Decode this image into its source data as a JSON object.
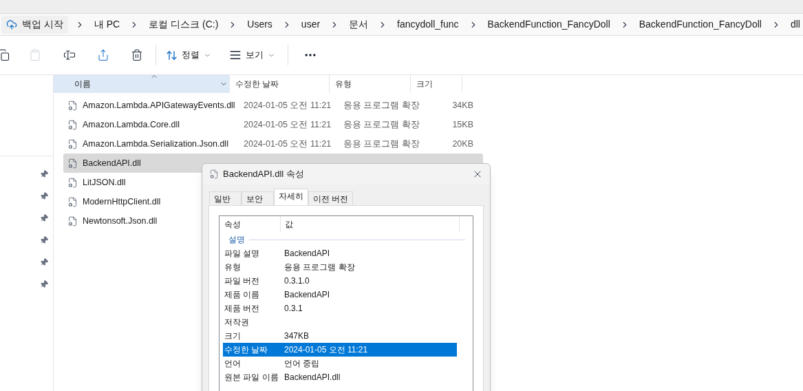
{
  "address_bar": {
    "backup_button": "백업 시작",
    "path": [
      "내 PC",
      "로컬 디스크 (C:)",
      "Users",
      "user",
      "문서",
      "fancydoll_func",
      "BackendFunction_FancyDoll",
      "BackendFunction_FancyDoll",
      "dll"
    ]
  },
  "toolbar": {
    "sort": "정렬",
    "view": "보기"
  },
  "table": {
    "columns": [
      {
        "label": "이름",
        "selected": true
      },
      {
        "label": "수정한 날짜",
        "selected": false
      },
      {
        "label": "유형",
        "selected": false
      },
      {
        "label": "크기",
        "selected": false
      }
    ],
    "rows": [
      {
        "name": "Amazon.Lambda.APIGatewayEvents.dll",
        "date": "2024-01-05 오전 11:21",
        "type": "응용 프로그램 확장",
        "size": "34KB",
        "selected": false
      },
      {
        "name": "Amazon.Lambda.Core.dll",
        "date": "2024-01-05 오전 11:21",
        "type": "응용 프로그램 확장",
        "size": "15KB",
        "selected": false
      },
      {
        "name": "Amazon.Lambda.Serialization.Json.dll",
        "date": "2024-01-05 오전 11:21",
        "type": "응용 프로그램 확장",
        "size": "20KB",
        "selected": false
      },
      {
        "name": "BackendAPI.dll",
        "selected": true
      },
      {
        "name": "LitJSON.dll",
        "selected": false
      },
      {
        "name": "ModernHttpClient.dll",
        "selected": false
      },
      {
        "name": "Newtonsoft.Json.dll",
        "selected": false
      }
    ]
  },
  "dialog": {
    "title": "BackendAPI.dll 속성",
    "tabs": [
      {
        "label": "일반",
        "selected": false
      },
      {
        "label": "보안",
        "selected": false
      },
      {
        "label": "자세히",
        "selected": true
      },
      {
        "label": "이전 버전",
        "selected": false
      }
    ],
    "columns": [
      "속성",
      "값"
    ],
    "rows": [
      {
        "kind": "section",
        "label": "설명"
      },
      {
        "kind": "property",
        "label": "파일 설명",
        "value": "BackendAPI",
        "selected": false
      },
      {
        "kind": "property",
        "label": "유형",
        "value": "응용 프로그램 확장",
        "selected": false
      },
      {
        "kind": "property",
        "label": "파일 버전",
        "value": "0.3.1.0",
        "selected": false
      },
      {
        "kind": "property",
        "label": "제품 이름",
        "value": "BackendAPI",
        "selected": false
      },
      {
        "kind": "property",
        "label": "제품 버전",
        "value": "0.3.1",
        "selected": false
      },
      {
        "kind": "property",
        "label": "저작권",
        "selected": false
      },
      {
        "kind": "property",
        "label": "크기",
        "value": "347KB",
        "selected": false
      },
      {
        "kind": "property",
        "label": "수정한 날짜",
        "value": "2024-01-05 오전 11:21",
        "selected": true
      },
      {
        "kind": "property",
        "label": "언어",
        "value": "언어 중립",
        "selected": false
      },
      {
        "kind": "property",
        "label": "원본 파일 이름",
        "value": "BackendAPI.dll",
        "selected": false
      }
    ]
  }
}
